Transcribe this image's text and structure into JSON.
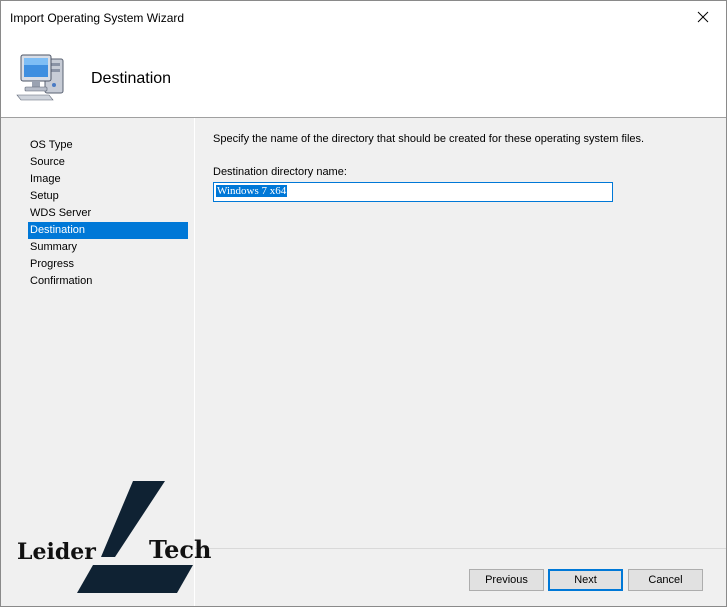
{
  "window": {
    "title": "Import Operating System Wizard"
  },
  "header": {
    "title": "Destination",
    "icon": "computer-icon"
  },
  "nav": {
    "items": [
      {
        "label": "OS Type",
        "active": false
      },
      {
        "label": "Source",
        "active": false
      },
      {
        "label": "Image",
        "active": false
      },
      {
        "label": "Setup",
        "active": false
      },
      {
        "label": "WDS Server",
        "active": false
      },
      {
        "label": "Destination",
        "active": true
      },
      {
        "label": "Summary",
        "active": false
      },
      {
        "label": "Progress",
        "active": false
      },
      {
        "label": "Confirmation",
        "active": false
      }
    ]
  },
  "main": {
    "instruction": "Specify the name of the directory that should be created for these operating system files.",
    "field_label": "Destination directory name:",
    "field_value": "Windows 7 x64"
  },
  "buttons": {
    "previous": "Previous",
    "next": "Next",
    "cancel": "Cancel"
  },
  "watermark": {
    "left": "Leider",
    "right": "Tech"
  },
  "colors": {
    "accent": "#0078d7",
    "panel_bg": "#f0f0f0"
  }
}
